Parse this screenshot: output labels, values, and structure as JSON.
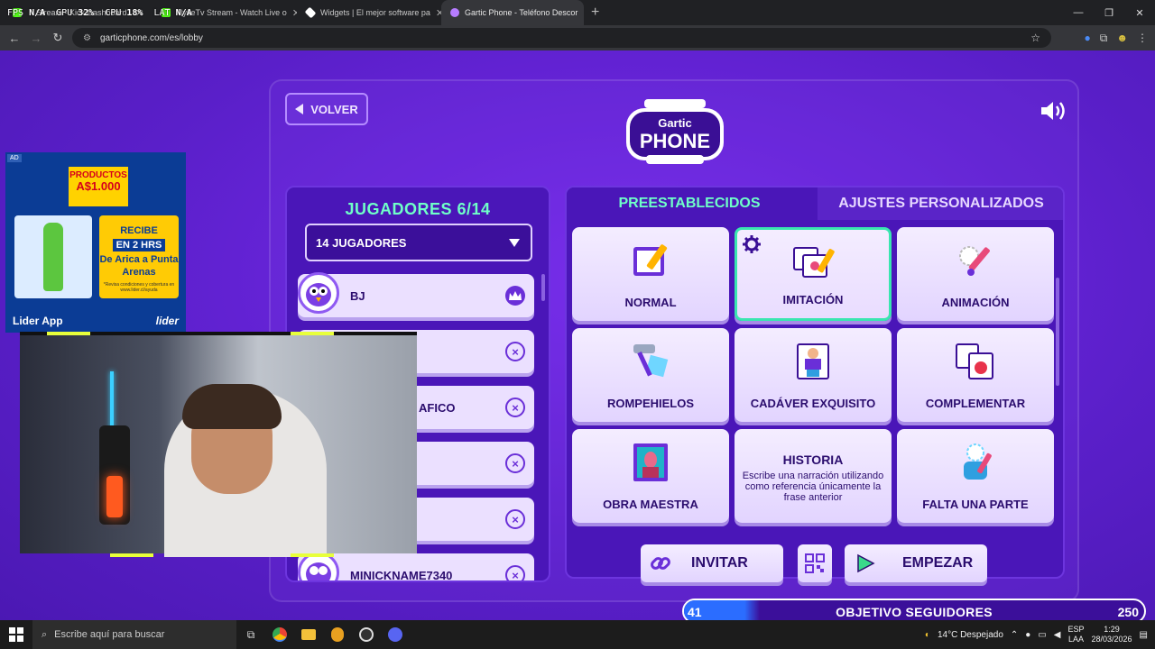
{
  "browser": {
    "tabs": [
      {
        "label": "Stream - Kick Dashboard",
        "color": "#53fc18"
      },
      {
        "label": "FlyzeTv Stream - Watch Live o",
        "color": "#53fc18"
      },
      {
        "label": "Widgets | El mejor software pa",
        "color": "#ffffff"
      },
      {
        "label": "Gartic Phone - Teléfono Descor",
        "color": "#b67cff"
      }
    ],
    "new_tab": "+",
    "url": "garticphone.com/es/lobby",
    "overlay": {
      "fps_label": "FPS",
      "fps": "N/A",
      "gpu_label": "GPU",
      "gpu": "32%",
      "cpu_label": "CPU",
      "cpu": "18%",
      "lat_label": "LAT",
      "lat": "N/A"
    }
  },
  "game": {
    "back_label": "VOLVER",
    "logo_top": "Gartic",
    "logo_main": "PHONE",
    "players": {
      "title": "JUGADORES 6/14",
      "select_value": "14 JUGADORES",
      "list": [
        {
          "name": "BJ",
          "role": "host"
        },
        {
          "name": "",
          "role": "guest"
        },
        {
          "name": "AFICO",
          "role": "guest"
        },
        {
          "name": "",
          "role": "guest"
        },
        {
          "name": "",
          "role": "guest"
        },
        {
          "name": "MINICKNAME7340",
          "role": "guest"
        }
      ],
      "kick_glyph": "×"
    },
    "tabs": {
      "preset": "PREESTABLECIDOS",
      "custom": "AJUSTES PERSONALIZADOS"
    },
    "modes": [
      {
        "label": "NORMAL",
        "icon": "normal-icon"
      },
      {
        "label": "IMITACIÓN",
        "icon": "imitation-icon",
        "selected": true
      },
      {
        "label": "ANIMACIÓN",
        "icon": "animation-icon"
      },
      {
        "label": "ROMPEHIELOS",
        "icon": "icebreaker-icon"
      },
      {
        "label": "CADÁVER EXQUISITO",
        "icon": "exquisite-corpse-icon"
      },
      {
        "label": "COMPLEMENTAR",
        "icon": "complement-icon"
      },
      {
        "label": "OBRA MAESTRA",
        "icon": "masterpiece-icon"
      },
      {
        "label": "HISTORIA",
        "icon": "story-icon",
        "description": "Escribe una narración utilizando como referencia únicamente la frase anterior"
      },
      {
        "label": "FALTA UNA PARTE",
        "icon": "missing-piece-icon"
      }
    ],
    "invite_label": "INVITAR",
    "start_label": "EMPEZAR"
  },
  "ad": {
    "badge": "AD",
    "price_top": "PRODUCTOS",
    "price_value": "A$1.000",
    "info_line1": "RECIBE",
    "info_highlight": "EN 2 HRS",
    "info_line2": "De Arica a Punta Arenas",
    "info_fine": "*Revisa condiciones y cobertura en www.lider.cl/ayuda",
    "brand_left": "Lider App",
    "brand_right": "lider"
  },
  "goal": {
    "current": "41",
    "label": "OBJETIVO SEGUIDORES",
    "target": "250",
    "progress": 0.164
  },
  "taskbar": {
    "search_placeholder": "Escribe aquí para buscar",
    "weather": "14°C  Despejado",
    "lang_top": "ESP",
    "lang_bottom": "LAA",
    "time": "1:29",
    "date": "28/03/2026"
  }
}
